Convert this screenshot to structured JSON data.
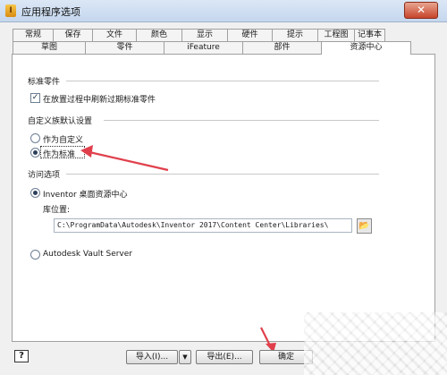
{
  "window": {
    "title": "应用程序选项",
    "close_symbol": "✕"
  },
  "tabs_row1": [
    "常规",
    "保存",
    "文件",
    "颜色",
    "显示",
    "硬件",
    "提示",
    "工程图",
    "记事本"
  ],
  "tabs_row2": [
    "草图",
    "零件",
    "iFeature",
    "部件",
    "资源中心"
  ],
  "active_tab": "资源中心",
  "panel": {
    "std_parts_label": "标准零件",
    "std_parts_checkbox": "在放置过程中刷新过期标准零件",
    "custom_family_label": "自定义族默认设置",
    "radio_as_custom": "作为自定义",
    "radio_as_standard": "作为标准",
    "access_label": "访问选项",
    "radio_desktop": "Inventor 桌面资源中心",
    "library_location_label": "库位置:",
    "library_path": "C:\\ProgramData\\Autodesk\\Inventor 2017\\Content Center\\Libraries\\",
    "radio_vault": "Autodesk Vault Server",
    "browse_icon": "folder-browse-icon"
  },
  "buttons": {
    "help": "?",
    "import": "导入(I)...",
    "export": "导出(E)...",
    "ok": "确定",
    "dropdown": "▼"
  },
  "colors": {
    "annotation_arrow": "#e0404c",
    "title_gradient": "#c5d7ee"
  }
}
